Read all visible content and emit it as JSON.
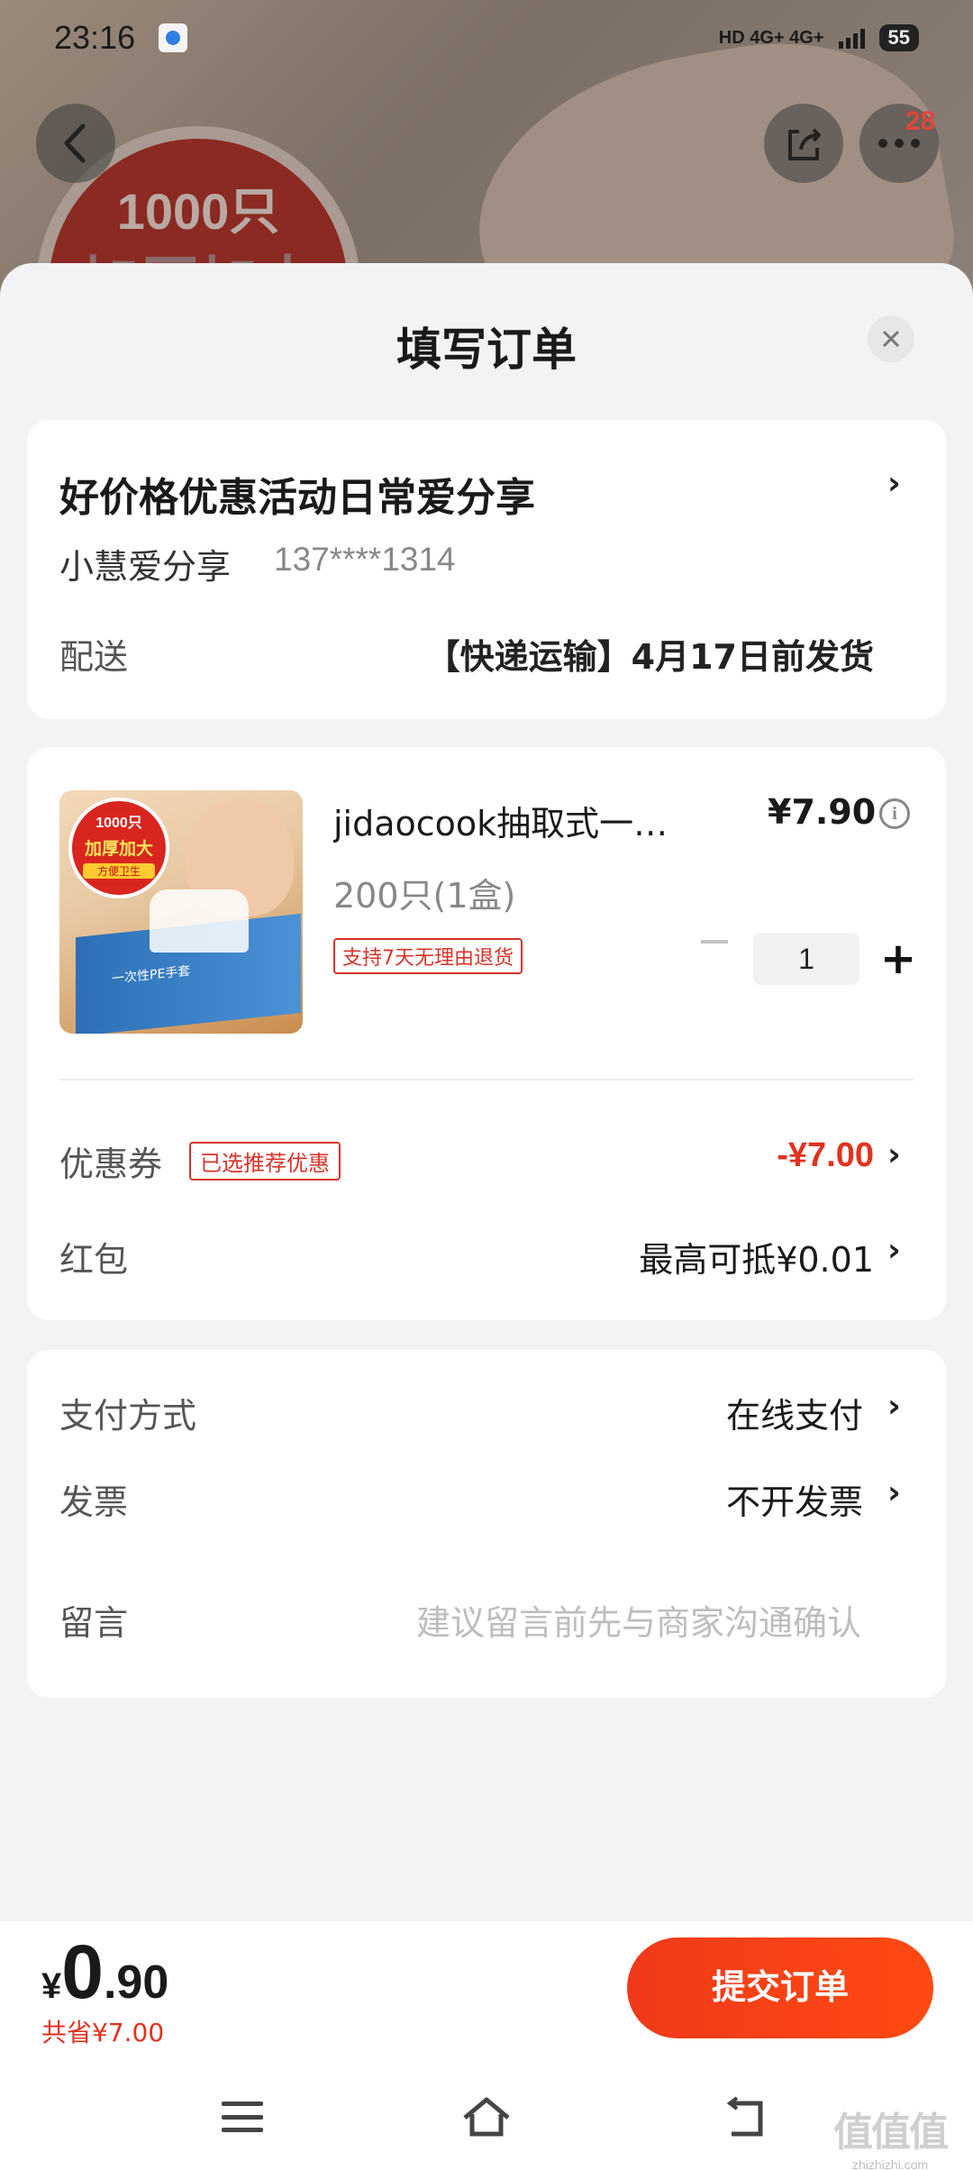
{
  "status_bar": {
    "time": "23:16",
    "network": "HD 4G+ 4G+",
    "battery": "55"
  },
  "top_nav": {
    "notification_count": "28"
  },
  "background": {
    "badge_line1": "1000只",
    "badge_line2": "加厚加大"
  },
  "sheet": {
    "title": "填写订单"
  },
  "address": {
    "title": "好价格优惠活动日常爱分享",
    "name": "小慧爱分享",
    "phone": "137****1314",
    "shipping_label": "配送",
    "shipping_value": "【快递运输】4月17日前发货"
  },
  "product": {
    "name": "jidaocook抽取式一次性PE手套",
    "price": "¥7.90",
    "spec": "200只(1盒)",
    "return_tag": "支持7天无理由退货",
    "quantity": "1",
    "image_text": {
      "seal_line1": "1000只",
      "seal_line2": "加厚加大",
      "seal_line3": "方便卫生",
      "box_label": "一次性PE手套"
    }
  },
  "discounts": {
    "coupon_label": "优惠券",
    "coupon_tag": "已选推荐优惠",
    "coupon_value": "-¥7.00",
    "redpacket_label": "红包",
    "redpacket_value": "最高可抵¥0.01"
  },
  "payment": {
    "method_label": "支付方式",
    "method_value": "在线支付",
    "invoice_label": "发票",
    "invoice_value": "不开发票",
    "note_label": "留言",
    "note_placeholder": "建议留言前先与商家沟通确认"
  },
  "footer": {
    "currency": "¥",
    "total_int": "0",
    "total_dec": ".90",
    "saved": "共省¥7.00",
    "submit_label": "提交订单"
  },
  "watermark": {
    "logo": "值值值",
    "text": "zhizhizhi.com"
  },
  "colors": {
    "accent": "#e1321f",
    "button": "#f0391a",
    "sheet_bg": "#f3f3f5"
  },
  "icons": [
    "back-arrow-icon",
    "share-icon",
    "more-icon",
    "close-icon",
    "chevron-right-icon",
    "info-icon",
    "minus-icon",
    "plus-icon",
    "menu-icon",
    "home-icon",
    "back-nav-icon"
  ]
}
